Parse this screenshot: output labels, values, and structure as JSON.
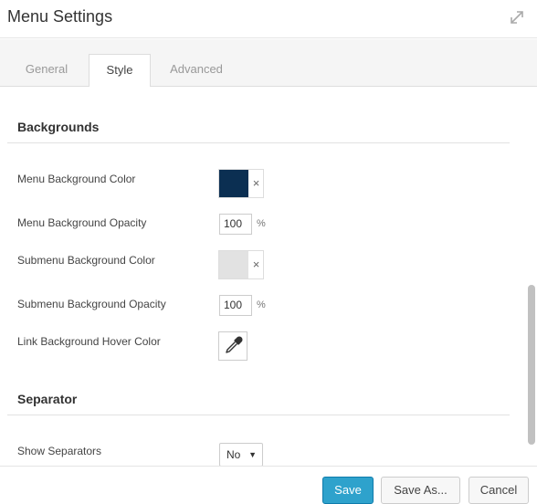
{
  "window": {
    "title": "Menu Settings",
    "expand_icon": "expand-icon"
  },
  "tabs": [
    {
      "label": "General",
      "active": false
    },
    {
      "label": "Style",
      "active": true
    },
    {
      "label": "Advanced",
      "active": false
    }
  ],
  "sections": {
    "backgrounds": {
      "title": "Backgrounds",
      "menu_bg_color": {
        "label": "Menu Background Color",
        "color": "#0b2f52",
        "clear_label": "×"
      },
      "menu_bg_opacity": {
        "label": "Menu Background Opacity",
        "value": "100",
        "unit": "%"
      },
      "submenu_bg_color": {
        "label": "Submenu Background Color",
        "color": "#e2e2e2",
        "clear_label": "×"
      },
      "submenu_bg_opacity": {
        "label": "Submenu Background Opacity",
        "value": "100",
        "unit": "%"
      },
      "link_bg_hover_color": {
        "label": "Link Background Hover Color",
        "icon": "eyedropper-icon"
      }
    },
    "separator": {
      "title": "Separator",
      "show_separators": {
        "label": "Show Separators",
        "value": "No",
        "caret": "▼"
      }
    }
  },
  "footer": {
    "save_label": "Save",
    "save_as_label": "Save As...",
    "cancel_label": "Cancel"
  },
  "colors": {
    "accent": "#2ea2cc"
  }
}
